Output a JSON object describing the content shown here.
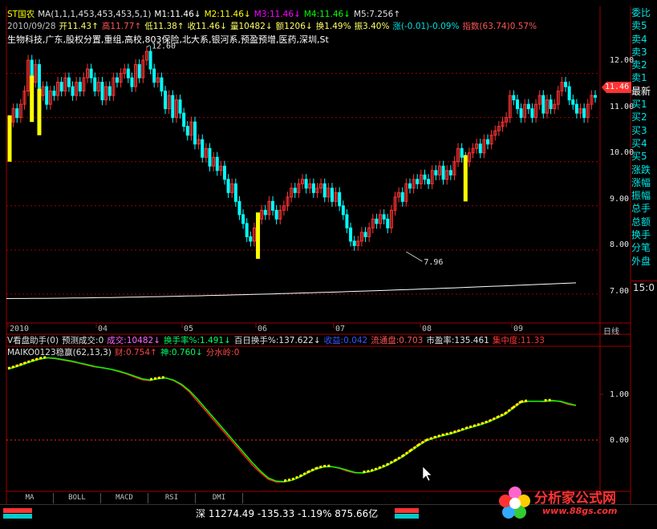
{
  "header": {
    "line1": [
      {
        "t": "ST国农",
        "c": "#ffff00"
      },
      {
        "t": "MA(1,1,1,453,453,453,5,1)",
        "c": "#e0e0e0"
      },
      {
        "t": "M1:11.46↓",
        "c": "#ffffff"
      },
      {
        "t": "M2:11.46↓",
        "c": "#ffff00"
      },
      {
        "t": "M3:11.46↓",
        "c": "#ff00ff"
      },
      {
        "t": "M4:11.46↓",
        "c": "#00ff00"
      },
      {
        "t": "M5:7.256↑",
        "c": "#e0e0e0"
      }
    ],
    "line2": [
      {
        "t": "2010/09/28",
        "c": "#c0c0c0"
      },
      {
        "t": "开11.43↑",
        "c": "#ffff66"
      },
      {
        "t": "高11.77↑",
        "c": "#ff5555"
      },
      {
        "t": "低11.38↑",
        "c": "#ffff66"
      },
      {
        "t": "收11.46↓",
        "c": "#ffff66"
      },
      {
        "t": "量10482↓",
        "c": "#ffff66"
      },
      {
        "t": "额1206↓",
        "c": "#ffff66"
      },
      {
        "t": "换1.49%",
        "c": "#ffff66"
      },
      {
        "t": "振3.40%",
        "c": "#ffff66"
      },
      {
        "t": "涨(-0.01)-0.09%",
        "c": "#00e0e0"
      },
      {
        "t": "指数(63.74)0.57%",
        "c": "#ff5555"
      }
    ],
    "line3": "生物科技,广东,股权分置,重组,高校,803保险,北大系,银河系,预盈预增,医药,深圳,St"
  },
  "vol_bar": [
    {
      "t": "V看盘助手(0)",
      "c": "#e0e0e0"
    },
    {
      "t": "预测成交:0",
      "c": "#e0e0e0"
    },
    {
      "t": "成交:10482↓",
      "c": "#ff66ff"
    },
    {
      "t": "换手率%:1.491↓",
      "c": "#00ff66"
    },
    {
      "t": "百日换手%:137.622↓",
      "c": "#e0e0e0"
    },
    {
      "t": "收益:0.042",
      "c": "#3355ff"
    },
    {
      "t": "流通盘:0.703",
      "c": "#ff5555"
    },
    {
      "t": "市盈率:135.461",
      "c": "#e0e0e0"
    },
    {
      "t": "集中度:11.33",
      "c": "#ff3333"
    }
  ],
  "ind_bar": [
    {
      "t": "MAIKO0123稳赢(62,13,3)",
      "c": "#e0e0e0"
    },
    {
      "t": "财:0.754↑",
      "c": "#ff4444"
    },
    {
      "t": "神:0.760↓",
      "c": "#00ff66"
    },
    {
      "t": "分水岭:0",
      "c": "#ff4444"
    }
  ],
  "side_panel": {
    "items": [
      "委比",
      "卖5",
      "卖4",
      "卖3",
      "卖2",
      "卖1",
      "最新",
      "买1",
      "买2",
      "买3",
      "买4",
      "买5",
      "涨跌",
      "涨幅",
      "振幅",
      "总手",
      "总额",
      "换手",
      "分笔",
      "外盘"
    ],
    "time": "15:0"
  },
  "tabs": [
    "MA",
    "BOLL",
    "MACD",
    "RSI",
    "DMI"
  ],
  "status": {
    "text": "深 11274.49 -135.33 -1.19% 875.66亿"
  },
  "watermark": {
    "title": "分析家公式网",
    "url": "www.88gs.com"
  },
  "colors": {
    "up": "#ff3333",
    "down": "#00ffff",
    "ma": "#ffffff",
    "grid": "#a00000",
    "signal": "#ffff00",
    "line_red": "#ff2020",
    "line_green": "#00ff00"
  },
  "chart_data": [
    {
      "type": "candlestick",
      "name": "price",
      "y_ticks": [
        "12.00",
        "11.00",
        "10.00",
        "9.00",
        "8.00",
        "7.00"
      ],
      "ylim": [
        6.4,
        13.3
      ],
      "x_ticks": [
        "2010",
        "04",
        "05",
        "06",
        "07",
        "08",
        "09",
        "日线"
      ],
      "current_price": "11.46",
      "annotations": [
        {
          "label": "12.60",
          "x_index": 37,
          "y": 12.6
        },
        {
          "label": "7.96",
          "x_index": 107,
          "y": 7.96
        }
      ],
      "close": [
        10.9,
        11.2,
        11.0,
        11.3,
        11.6,
        12.3,
        11.8,
        12.2,
        11.5,
        11.7,
        11.3,
        11.6,
        11.5,
        11.8,
        11.6,
        11.9,
        11.7,
        11.5,
        11.8,
        11.6,
        11.9,
        12.1,
        11.9,
        11.6,
        11.8,
        11.4,
        11.7,
        11.5,
        11.9,
        11.8,
        12.0,
        12.1,
        11.9,
        11.7,
        12.2,
        11.9,
        12.3,
        12.5,
        12.1,
        11.8,
        11.9,
        11.6,
        11.2,
        11.5,
        11.0,
        11.4,
        11.1,
        10.8,
        10.6,
        10.9,
        10.4,
        10.5,
        10.1,
        10.3,
        9.9,
        10.1,
        9.8,
        9.9,
        9.6,
        9.3,
        9.5,
        9.1,
        8.8,
        8.6,
        8.3,
        8.2,
        8.5,
        8.7,
        8.9,
        8.8,
        9.1,
        8.9,
        8.7,
        8.9,
        9.0,
        9.2,
        9.4,
        9.3,
        9.5,
        9.6,
        9.4,
        9.5,
        9.3,
        9.4,
        9.5,
        9.2,
        9.4,
        9.1,
        9.3,
        9.0,
        8.8,
        8.5,
        8.2,
        8.1,
        8.2,
        8.4,
        8.3,
        8.5,
        8.7,
        8.6,
        8.8,
        8.7,
        8.5,
        8.9,
        9.2,
        9.3,
        9.1,
        9.5,
        9.4,
        9.6,
        9.5,
        9.7,
        9.6,
        9.5,
        9.8,
        9.7,
        9.9,
        9.6,
        9.8,
        9.7,
        10.0,
        10.3,
        10.1,
        10.0,
        10.2,
        10.3,
        10.4,
        10.2,
        10.5,
        10.4,
        10.6,
        10.7,
        10.8,
        10.9,
        11.0,
        11.5,
        11.4,
        11.2,
        11.0,
        11.3,
        11.2,
        11.0,
        11.3,
        11.5,
        11.1,
        11.4,
        11.2,
        11.3,
        11.6,
        11.8,
        11.7,
        11.4,
        11.3,
        11.1,
        11.2,
        11.0,
        11.3,
        11.5,
        11.46
      ],
      "ma_long": {
        "start": 6.9,
        "end": 7.256
      },
      "signals_x_index": [
        0,
        6,
        8,
        67,
        123
      ]
    },
    {
      "type": "line",
      "name": "MAIKO0123稳赢",
      "y_ticks": [
        "1.00",
        "0.00"
      ],
      "series": [
        {
          "name": "财",
          "values": [
            1.55,
            1.62,
            1.68,
            1.73,
            1.78,
            1.8,
            1.78,
            1.75,
            1.72,
            1.68,
            1.64,
            1.6,
            1.58,
            1.55,
            1.5,
            1.45,
            1.38,
            1.32,
            1.3,
            1.35,
            1.36,
            1.3,
            1.2,
            1.05,
            0.85,
            0.65,
            0.45,
            0.25,
            0.05,
            -0.15,
            -0.35,
            -0.55,
            -0.72,
            -0.86,
            -0.92,
            -0.92,
            -0.88,
            -0.8,
            -0.7,
            -0.62,
            -0.58,
            -0.58,
            -0.62,
            -0.68,
            -0.72,
            -0.72,
            -0.68,
            -0.62,
            -0.55,
            -0.45,
            -0.35,
            -0.22,
            -0.1,
            0.0,
            0.05,
            0.1,
            0.14,
            0.2,
            0.25,
            0.3,
            0.35,
            0.42,
            0.5,
            0.58,
            0.72,
            0.85,
            0.85,
            0.85,
            0.84,
            0.87,
            0.84,
            0.78,
            0.754
          ]
        },
        {
          "name": "神",
          "values": [
            1.55,
            1.6,
            1.66,
            1.72,
            1.77,
            1.8,
            1.79,
            1.76,
            1.73,
            1.69,
            1.65,
            1.61,
            1.58,
            1.55,
            1.51,
            1.46,
            1.4,
            1.34,
            1.31,
            1.34,
            1.36,
            1.31,
            1.22,
            1.08,
            0.9,
            0.7,
            0.5,
            0.3,
            0.1,
            -0.1,
            -0.3,
            -0.5,
            -0.68,
            -0.83,
            -0.9,
            -0.91,
            -0.88,
            -0.81,
            -0.72,
            -0.64,
            -0.59,
            -0.58,
            -0.61,
            -0.66,
            -0.71,
            -0.72,
            -0.69,
            -0.63,
            -0.56,
            -0.47,
            -0.37,
            -0.25,
            -0.13,
            -0.02,
            0.04,
            0.09,
            0.13,
            0.18,
            0.24,
            0.29,
            0.34,
            0.4,
            0.48,
            0.56,
            0.69,
            0.82,
            0.85,
            0.85,
            0.85,
            0.86,
            0.85,
            0.8,
            0.76
          ]
        }
      ]
    }
  ]
}
